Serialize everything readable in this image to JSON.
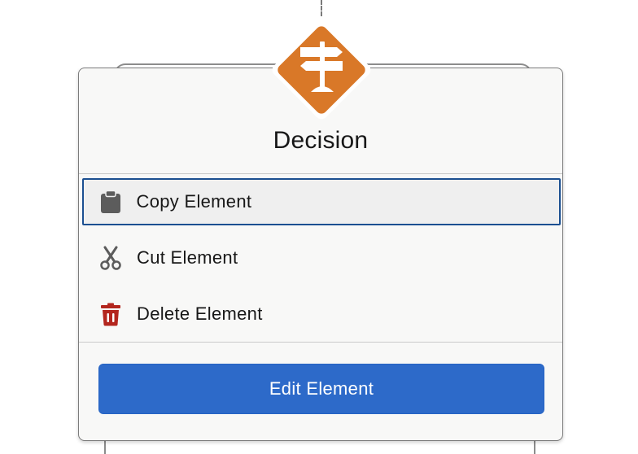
{
  "element": {
    "type_label": "Decision",
    "icon": "signpost-icon",
    "icon_color": "#d97828"
  },
  "menu": {
    "items": [
      {
        "label": "Copy Element",
        "icon": "clipboard-icon",
        "icon_color": "#5c5c5c",
        "selected": true
      },
      {
        "label": "Cut Element",
        "icon": "scissors-icon",
        "icon_color": "#5c5c5c",
        "selected": false
      },
      {
        "label": "Delete Element",
        "icon": "trash-icon",
        "icon_color": "#b3261e",
        "selected": false
      }
    ]
  },
  "footer": {
    "edit_label": "Edit Element",
    "button_color": "#2d6ac9"
  },
  "colors": {
    "selection_border": "#1b4f91"
  }
}
